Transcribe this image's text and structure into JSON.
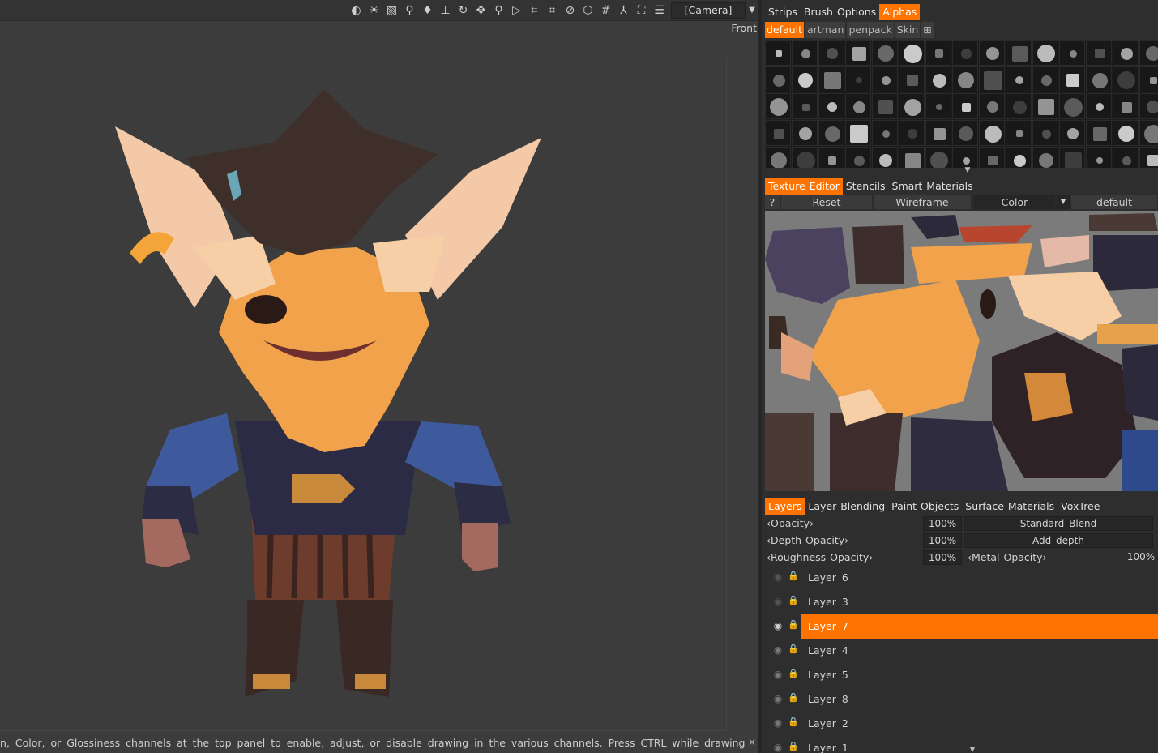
{
  "viewport": {
    "toolbar_icons": [
      "contrast-icon",
      "light-icon",
      "image-icon",
      "dropper-icon",
      "drop-icon",
      "turntable-icon",
      "rotate-icon",
      "move-icon",
      "zoom-icon",
      "play-icon",
      "all-icon",
      "pen-icon",
      "disable-icon",
      "cube-icon",
      "grid-icon",
      "axis-icon",
      "frame-icon",
      "layers-view-icon"
    ],
    "camera": "[Camera]",
    "view_label": "Front",
    "status_text": "n, Color, or Glossiness channels at the top panel to enable, adjust, or disable drawing in the various channels. Press CTRL while drawing",
    "colors": {
      "background": "#3c3c3c",
      "fur": "#f2a24b",
      "hat": "#3f2f2b",
      "coat": "#3f5a9c"
    }
  },
  "alphas_panel": {
    "tabs": [
      "Strips",
      "Brush Options",
      "Alphas"
    ],
    "active_tab": "Alphas",
    "subtabs": [
      "default",
      "artman",
      "penpack",
      "Skin"
    ],
    "active_subtab": "default",
    "add_button": "⊞"
  },
  "texture_panel": {
    "tabs": [
      "Texture Editor",
      "Stencils",
      "Smart Materials"
    ],
    "active_tab": "Texture Editor",
    "help": "?",
    "reset": "Reset",
    "wireframe": "Wireframe",
    "channel": "Color",
    "material": "default"
  },
  "layers_panel": {
    "tabs": [
      "Layers",
      "Layer Blending",
      "Paint Objects",
      "Surface Materials",
      "VoxTree"
    ],
    "active_tab": "Layers",
    "opacity_label": "Opacity",
    "opacity_value": "100%",
    "blend_mode": "Standard Blend",
    "depth_opacity_label": "Depth Opacity",
    "depth_opacity_value": "100%",
    "depth_mode": "Add depth",
    "roughness_opacity_label": "Roughness Opacity",
    "roughness_opacity_value": "100%",
    "metal_opacity_label": "Metal Opacity",
    "metal_opacity_value": "100%",
    "layers": [
      {
        "name": "Layer 6",
        "visible": false,
        "selected": false
      },
      {
        "name": "Layer 3",
        "visible": false,
        "selected": false
      },
      {
        "name": "Layer 7",
        "visible": true,
        "selected": true
      },
      {
        "name": "Layer 4",
        "visible": true,
        "selected": false
      },
      {
        "name": "Layer 5",
        "visible": true,
        "selected": false
      },
      {
        "name": "Layer 8",
        "visible": true,
        "selected": false
      },
      {
        "name": "Layer 2",
        "visible": true,
        "selected": false
      },
      {
        "name": "Layer 1",
        "visible": true,
        "selected": false
      }
    ],
    "accent": "#ff7400"
  }
}
